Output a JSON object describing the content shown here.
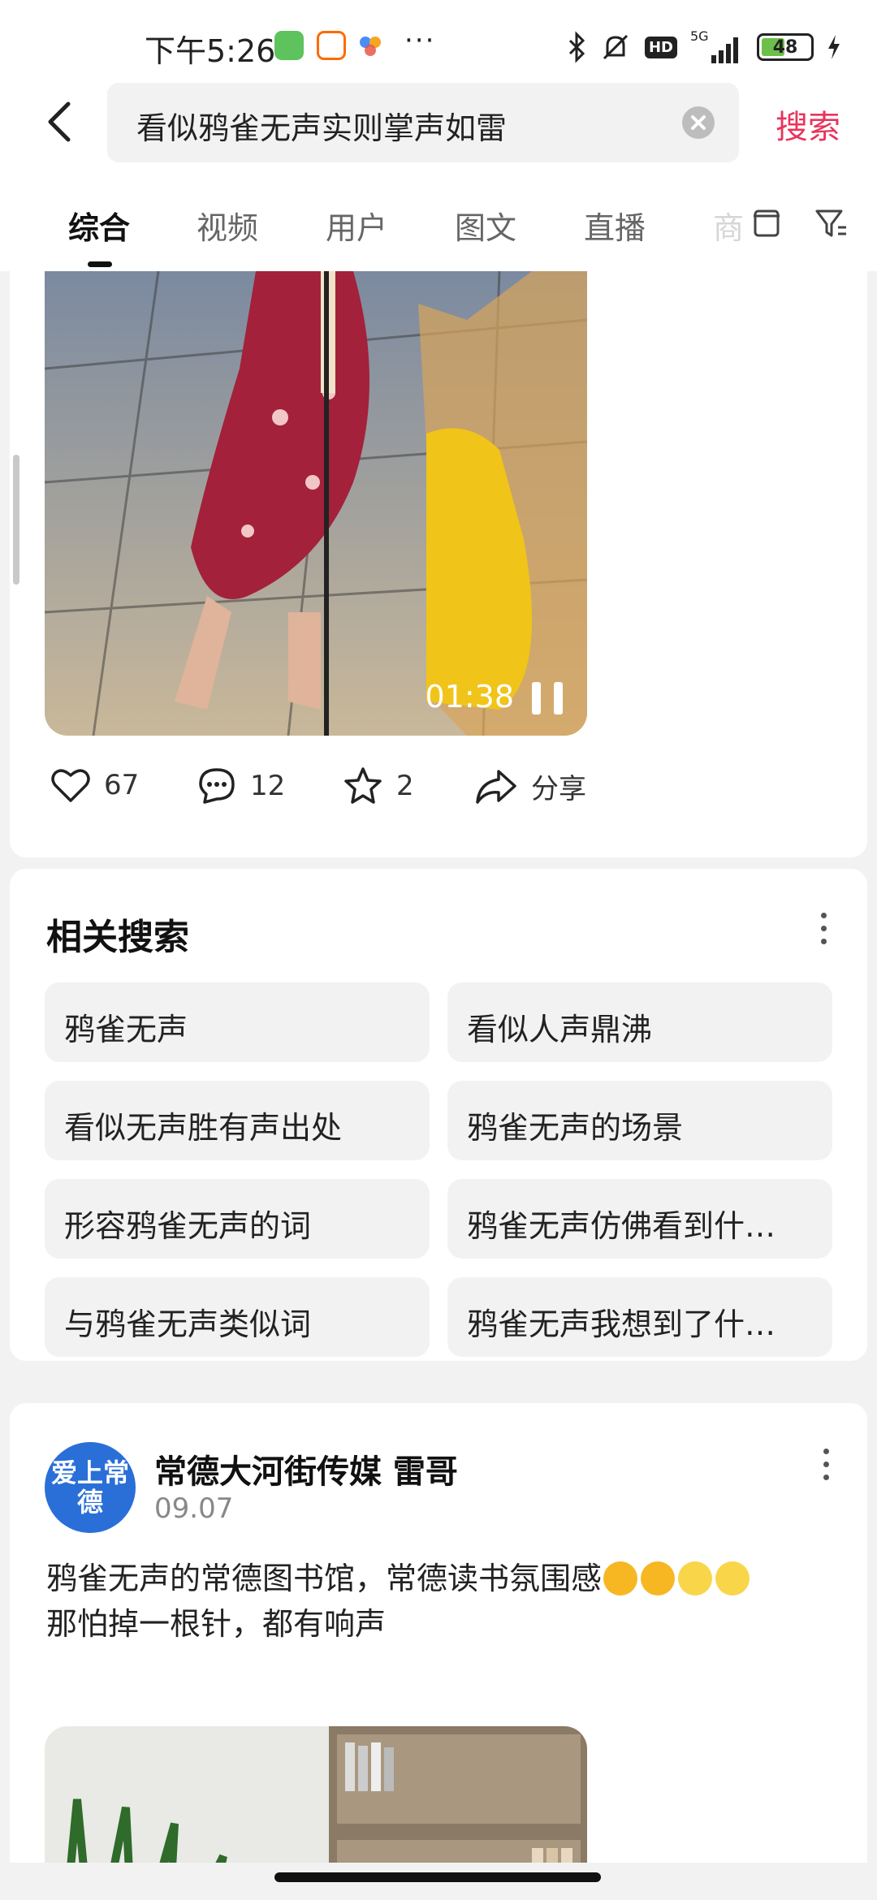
{
  "status": {
    "time": "下午5:26",
    "app_icons": [
      "wechat-icon",
      "58-icon",
      "baidu-icon"
    ],
    "more": "···",
    "network": "5G",
    "battery": "48"
  },
  "search": {
    "query": "看似鸦雀无声实则掌声如雷",
    "button": "搜索"
  },
  "tabs": [
    {
      "label": "综合",
      "active": true
    },
    {
      "label": "视频"
    },
    {
      "label": "用户"
    },
    {
      "label": "图文"
    },
    {
      "label": "直播"
    },
    {
      "label": "商"
    }
  ],
  "video1": {
    "duration": "01:38"
  },
  "actions": {
    "likes": "67",
    "comments": "12",
    "favorites": "2",
    "share": "分享"
  },
  "related": {
    "title": "相关搜索",
    "items": [
      "鸦雀无声",
      "看似人声鼎沸",
      "看似无声胜有声出处",
      "鸦雀无声的场景",
      "形容鸦雀无声的词",
      "鸦雀无声仿佛看到什…",
      "与鸦雀无声类似词",
      "鸦雀无声我想到了什…"
    ]
  },
  "post": {
    "avatar_text": "爱上常德",
    "author": "常德大河街传媒 雷哥",
    "date": "09.07",
    "text_line1": "鸦雀无声的常德图书馆，常德读书氛围感",
    "text_line2": "那怕掉一根针，都有响声",
    "emojis": [
      "shocked-emoji",
      "shocked-emoji",
      "flexed-arm-emoji",
      "flexed-arm-emoji"
    ]
  },
  "colors": {
    "accent": "#e8345e",
    "chip_bg": "#f2f2f2",
    "avatar_bg": "#2a6fd8"
  }
}
